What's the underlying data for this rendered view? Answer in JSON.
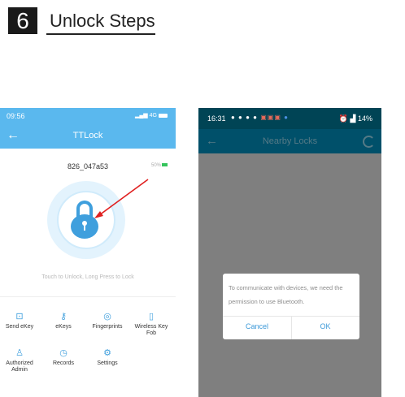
{
  "step": {
    "number": "6",
    "title": "Unlock Steps"
  },
  "left_phone": {
    "status_time": "09:56",
    "status_network": "4G",
    "nav_title": "TTLock",
    "lock_name": "826_047a53",
    "battery_percent": "50%",
    "hint": "Touch to Unlock, Long Press to Lock",
    "menu": [
      {
        "icon": "send-ekey-icon",
        "label": "Send eKey"
      },
      {
        "icon": "ekeys-icon",
        "label": "eKeys"
      },
      {
        "icon": "fingerprint-icon",
        "label": "Fingerprints"
      },
      {
        "icon": "key-fob-icon",
        "label": "Wireless Key Fob"
      },
      {
        "icon": "authorized-admin-icon",
        "label": "Authorized Admin"
      },
      {
        "icon": "records-icon",
        "label": "Records"
      },
      {
        "icon": "settings-icon",
        "label": "Settings"
      }
    ],
    "accent_color": "#5ab8ee",
    "annotation_arrow_color": "#e02020"
  },
  "right_phone": {
    "status_time": "16:31",
    "status_battery": "14%",
    "nav_title": "Nearby Locks",
    "dialog": {
      "message": "To communicate with devices, we need the permission to use Bluetooth.",
      "cancel": "Cancel",
      "ok": "OK"
    },
    "header_color": "#00506a"
  }
}
